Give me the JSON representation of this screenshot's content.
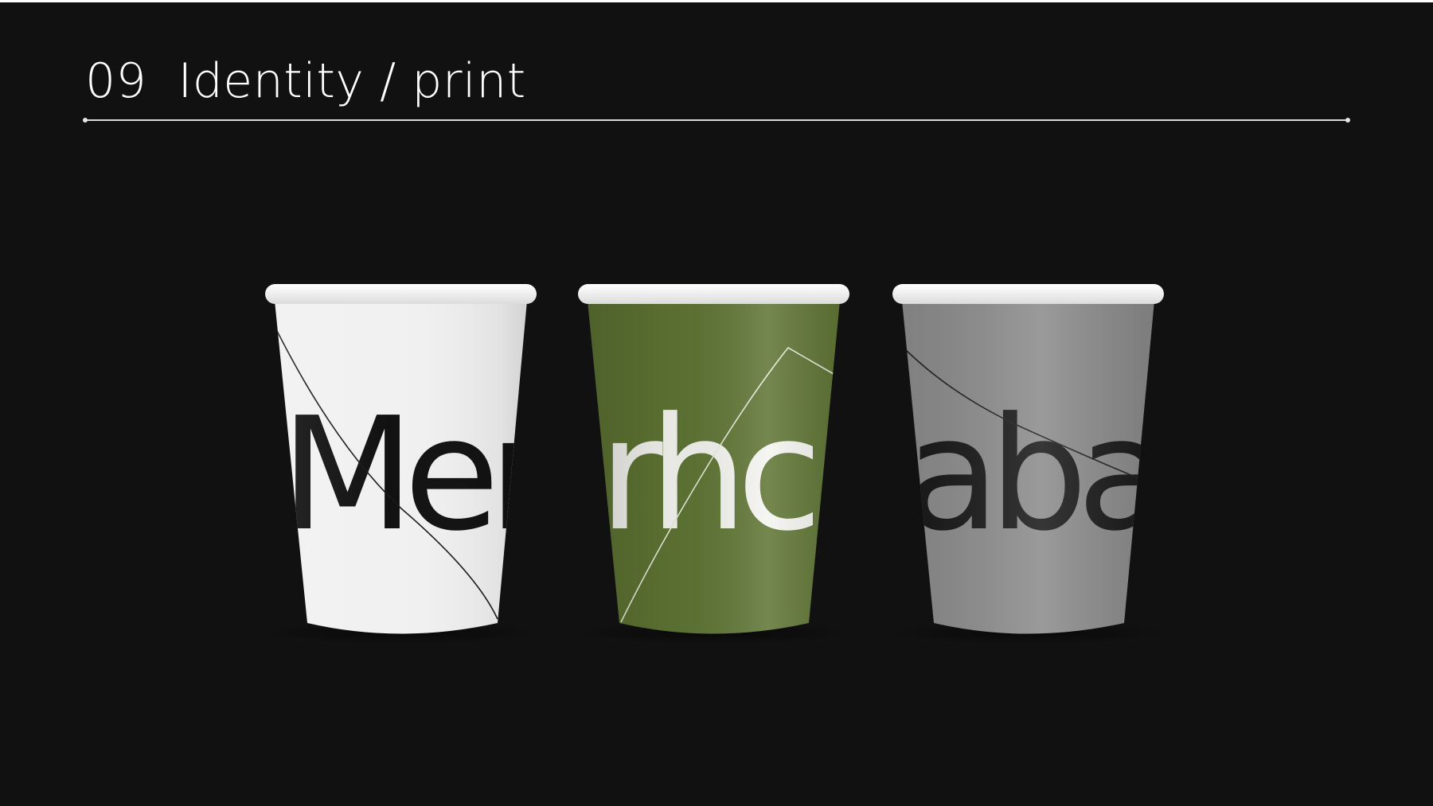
{
  "slide": {
    "title": "09  Identity / print"
  },
  "cups": [
    {
      "word": "Mer",
      "body_color": "#f1f1f1",
      "text_color": "#111111",
      "line_color": "#1a1a1a"
    },
    {
      "word": "rhca",
      "body_color": "#5e7433",
      "text_color": "#f4f4f0",
      "line_color": "#e8eddc"
    },
    {
      "word": "aba",
      "body_color": "#8a8a8a",
      "text_color": "#161616",
      "line_color": "#1e1e1e"
    }
  ],
  "colors": {
    "background": "#111111",
    "title": "#ffffff",
    "rule": "#d9d9d9",
    "rim": "#f3f3f3"
  }
}
